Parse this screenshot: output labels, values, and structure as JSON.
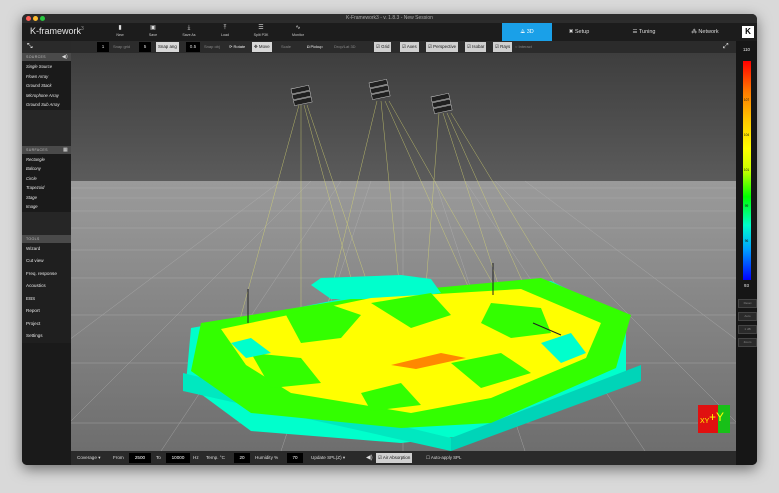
{
  "window": {
    "title": "K-Framework3 - v. 1.8.3 - New Session"
  },
  "app": {
    "logo": "K-framework",
    "version_sup": "3"
  },
  "toolbar": {
    "buttons": [
      {
        "label": "New",
        "icon": "new-file-icon"
      },
      {
        "label": "Save",
        "icon": "save-icon"
      },
      {
        "label": "Save As",
        "icon": "save-as-icon"
      },
      {
        "label": "Load",
        "icon": "load-icon"
      },
      {
        "label": "Split P3K",
        "icon": "split-icon"
      },
      {
        "label": "Monitor",
        "icon": "monitor-icon"
      }
    ]
  },
  "tabs": [
    {
      "label": "3D",
      "icon": "3d-icon",
      "active": true
    },
    {
      "label": "Setup",
      "icon": "setup-icon",
      "active": false
    },
    {
      "label": "Tuning",
      "icon": "tuning-icon",
      "active": false
    },
    {
      "label": "Network",
      "icon": "network-icon",
      "active": false
    }
  ],
  "brand_badge": "K",
  "options": {
    "value1": "1",
    "snap_grid_label": "Snap grid",
    "snap_grid_value": "5",
    "snap_ang_label": "Snap ang",
    "snap_ang_value": "0.5",
    "snap_obj_label": "Snap obj",
    "rotate_label": "Rotate",
    "move_label": "Move",
    "scale_label": "Scale",
    "pickup_label": "Pickup",
    "dropdown_label": "Drop/Lat 3D",
    "checks": [
      {
        "label": "Grid",
        "checked": true
      },
      {
        "label": "Axes",
        "checked": true
      },
      {
        "label": "Perspective",
        "checked": true
      },
      {
        "label": "Isobar",
        "checked": true
      },
      {
        "label": "Rays",
        "checked": true
      }
    ],
    "interact_label": "Interact"
  },
  "sidebar": {
    "sources_head": "SOURCES",
    "sources": [
      "Single Source",
      "Flown Array",
      "Ground Stack",
      "Microphone Array",
      "Ground Sub Array"
    ],
    "surfaces_head": "SURFACES",
    "surfaces": [
      "Rectangle",
      "Balcony",
      "Circle",
      "Trapezoid",
      "Stage",
      "Image"
    ],
    "tools_head": "TOOLS",
    "tools": [
      "Wizard",
      "Cut view",
      "Freq. response",
      "Acoustics",
      "EBS",
      "Report",
      "Project",
      "Settings"
    ]
  },
  "scale": {
    "max": "110",
    "min": "93",
    "ticks": [
      "107",
      "104",
      "101",
      "99",
      "96"
    ],
    "buttons": [
      "Reset",
      "Auto",
      "1 dB",
      "Zoom"
    ],
    "colors": [
      "#ff0000",
      "#ffff00",
      "#00ff00",
      "#00ffcc",
      "#0000ff"
    ]
  },
  "bottom": {
    "mode": "Coverage",
    "from_label": "From",
    "from_value": "2500",
    "to_label": "To",
    "to_value": "10000",
    "hz": "Hz",
    "temp_label": "Temp. °C",
    "temp_value": "20",
    "humidity_label": "Humidity %",
    "humidity_value": "70",
    "update_label": "Update SPL(Z)",
    "air_absorption": "Air Absorption",
    "auto_apply": "Auto-apply SPL"
  },
  "axis_gizmo": {
    "label": "+Y",
    "sub": "XY"
  },
  "colors": {
    "accent": "#1aa0e8",
    "coverage_yellow": "#ffff00",
    "coverage_green": "#33ff00",
    "coverage_cyan": "#00ffcc"
  }
}
